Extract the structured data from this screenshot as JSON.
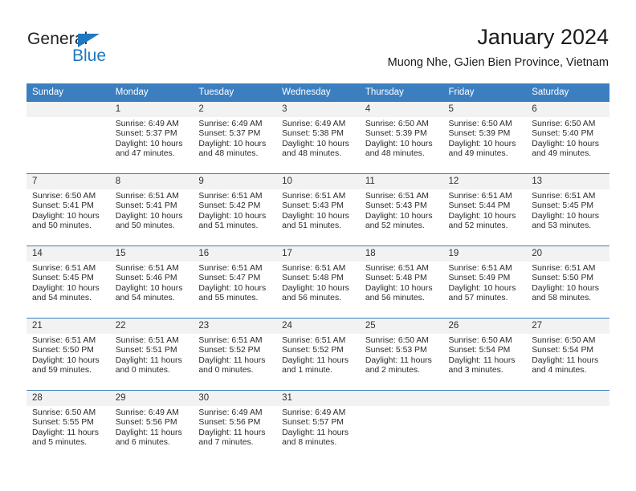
{
  "brand": {
    "name_top": "General",
    "name_bottom": "Blue",
    "triangle_color": "#1f78c1",
    "top_color": "#231f20",
    "bottom_color": "#1f78c1"
  },
  "header": {
    "title": "January 2024",
    "subtitle": "Muong Nhe, GJien Bien Province, Vietnam"
  },
  "theme": {
    "header_bg": "#3b7fc0",
    "header_text": "#ffffff",
    "daynum_bg": "#f2f2f2",
    "cell_bg": "#ffffff",
    "row_divider": "#3b7fc0"
  },
  "weekdays": [
    "Sunday",
    "Monday",
    "Tuesday",
    "Wednesday",
    "Thursday",
    "Friday",
    "Saturday"
  ],
  "weeks": [
    [
      {
        "day": "",
        "lines": []
      },
      {
        "day": "1",
        "lines": [
          "Sunrise: 6:49 AM",
          "Sunset: 5:37 PM",
          "Daylight: 10 hours",
          "and 47 minutes."
        ]
      },
      {
        "day": "2",
        "lines": [
          "Sunrise: 6:49 AM",
          "Sunset: 5:37 PM",
          "Daylight: 10 hours",
          "and 48 minutes."
        ]
      },
      {
        "day": "3",
        "lines": [
          "Sunrise: 6:49 AM",
          "Sunset: 5:38 PM",
          "Daylight: 10 hours",
          "and 48 minutes."
        ]
      },
      {
        "day": "4",
        "lines": [
          "Sunrise: 6:50 AM",
          "Sunset: 5:39 PM",
          "Daylight: 10 hours",
          "and 48 minutes."
        ]
      },
      {
        "day": "5",
        "lines": [
          "Sunrise: 6:50 AM",
          "Sunset: 5:39 PM",
          "Daylight: 10 hours",
          "and 49 minutes."
        ]
      },
      {
        "day": "6",
        "lines": [
          "Sunrise: 6:50 AM",
          "Sunset: 5:40 PM",
          "Daylight: 10 hours",
          "and 49 minutes."
        ]
      }
    ],
    [
      {
        "day": "7",
        "lines": [
          "Sunrise: 6:50 AM",
          "Sunset: 5:41 PM",
          "Daylight: 10 hours",
          "and 50 minutes."
        ]
      },
      {
        "day": "8",
        "lines": [
          "Sunrise: 6:51 AM",
          "Sunset: 5:41 PM",
          "Daylight: 10 hours",
          "and 50 minutes."
        ]
      },
      {
        "day": "9",
        "lines": [
          "Sunrise: 6:51 AM",
          "Sunset: 5:42 PM",
          "Daylight: 10 hours",
          "and 51 minutes."
        ]
      },
      {
        "day": "10",
        "lines": [
          "Sunrise: 6:51 AM",
          "Sunset: 5:43 PM",
          "Daylight: 10 hours",
          "and 51 minutes."
        ]
      },
      {
        "day": "11",
        "lines": [
          "Sunrise: 6:51 AM",
          "Sunset: 5:43 PM",
          "Daylight: 10 hours",
          "and 52 minutes."
        ]
      },
      {
        "day": "12",
        "lines": [
          "Sunrise: 6:51 AM",
          "Sunset: 5:44 PM",
          "Daylight: 10 hours",
          "and 52 minutes."
        ]
      },
      {
        "day": "13",
        "lines": [
          "Sunrise: 6:51 AM",
          "Sunset: 5:45 PM",
          "Daylight: 10 hours",
          "and 53 minutes."
        ]
      }
    ],
    [
      {
        "day": "14",
        "lines": [
          "Sunrise: 6:51 AM",
          "Sunset: 5:45 PM",
          "Daylight: 10 hours",
          "and 54 minutes."
        ]
      },
      {
        "day": "15",
        "lines": [
          "Sunrise: 6:51 AM",
          "Sunset: 5:46 PM",
          "Daylight: 10 hours",
          "and 54 minutes."
        ]
      },
      {
        "day": "16",
        "lines": [
          "Sunrise: 6:51 AM",
          "Sunset: 5:47 PM",
          "Daylight: 10 hours",
          "and 55 minutes."
        ]
      },
      {
        "day": "17",
        "lines": [
          "Sunrise: 6:51 AM",
          "Sunset: 5:48 PM",
          "Daylight: 10 hours",
          "and 56 minutes."
        ]
      },
      {
        "day": "18",
        "lines": [
          "Sunrise: 6:51 AM",
          "Sunset: 5:48 PM",
          "Daylight: 10 hours",
          "and 56 minutes."
        ]
      },
      {
        "day": "19",
        "lines": [
          "Sunrise: 6:51 AM",
          "Sunset: 5:49 PM",
          "Daylight: 10 hours",
          "and 57 minutes."
        ]
      },
      {
        "day": "20",
        "lines": [
          "Sunrise: 6:51 AM",
          "Sunset: 5:50 PM",
          "Daylight: 10 hours",
          "and 58 minutes."
        ]
      }
    ],
    [
      {
        "day": "21",
        "lines": [
          "Sunrise: 6:51 AM",
          "Sunset: 5:50 PM",
          "Daylight: 10 hours",
          "and 59 minutes."
        ]
      },
      {
        "day": "22",
        "lines": [
          "Sunrise: 6:51 AM",
          "Sunset: 5:51 PM",
          "Daylight: 11 hours",
          "and 0 minutes."
        ]
      },
      {
        "day": "23",
        "lines": [
          "Sunrise: 6:51 AM",
          "Sunset: 5:52 PM",
          "Daylight: 11 hours",
          "and 0 minutes."
        ]
      },
      {
        "day": "24",
        "lines": [
          "Sunrise: 6:51 AM",
          "Sunset: 5:52 PM",
          "Daylight: 11 hours",
          "and 1 minute."
        ]
      },
      {
        "day": "25",
        "lines": [
          "Sunrise: 6:50 AM",
          "Sunset: 5:53 PM",
          "Daylight: 11 hours",
          "and 2 minutes."
        ]
      },
      {
        "day": "26",
        "lines": [
          "Sunrise: 6:50 AM",
          "Sunset: 5:54 PM",
          "Daylight: 11 hours",
          "and 3 minutes."
        ]
      },
      {
        "day": "27",
        "lines": [
          "Sunrise: 6:50 AM",
          "Sunset: 5:54 PM",
          "Daylight: 11 hours",
          "and 4 minutes."
        ]
      }
    ],
    [
      {
        "day": "28",
        "lines": [
          "Sunrise: 6:50 AM",
          "Sunset: 5:55 PM",
          "Daylight: 11 hours",
          "and 5 minutes."
        ]
      },
      {
        "day": "29",
        "lines": [
          "Sunrise: 6:49 AM",
          "Sunset: 5:56 PM",
          "Daylight: 11 hours",
          "and 6 minutes."
        ]
      },
      {
        "day": "30",
        "lines": [
          "Sunrise: 6:49 AM",
          "Sunset: 5:56 PM",
          "Daylight: 11 hours",
          "and 7 minutes."
        ]
      },
      {
        "day": "31",
        "lines": [
          "Sunrise: 6:49 AM",
          "Sunset: 5:57 PM",
          "Daylight: 11 hours",
          "and 8 minutes."
        ]
      },
      {
        "day": "",
        "lines": []
      },
      {
        "day": "",
        "lines": []
      },
      {
        "day": "",
        "lines": []
      }
    ]
  ]
}
